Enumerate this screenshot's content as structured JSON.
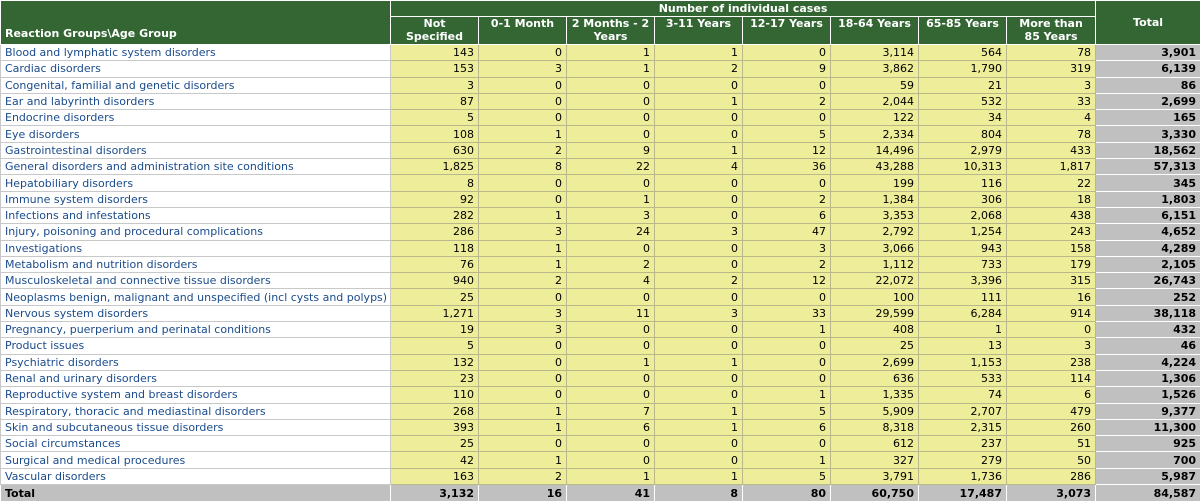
{
  "table": {
    "corner_label": "Reaction Groups\\Age Group",
    "group_label": "Number of individual cases",
    "columns": [
      "Not Specified",
      "0-1 Month",
      "2 Months - 2 Years",
      "3-11 Years",
      "12-17 Years",
      "18-64 Years",
      "65-85 Years",
      "More than 85 Years"
    ],
    "total_label": "Total",
    "rows": [
      {
        "name": "Blood and lymphatic system disorders",
        "values": [
          "143",
          "0",
          "1",
          "1",
          "0",
          "3,114",
          "564",
          "78"
        ],
        "total": "3,901"
      },
      {
        "name": "Cardiac disorders",
        "values": [
          "153",
          "3",
          "1",
          "2",
          "9",
          "3,862",
          "1,790",
          "319"
        ],
        "total": "6,139"
      },
      {
        "name": "Congenital, familial and genetic disorders",
        "values": [
          "3",
          "0",
          "0",
          "0",
          "0",
          "59",
          "21",
          "3"
        ],
        "total": "86"
      },
      {
        "name": "Ear and labyrinth disorders",
        "values": [
          "87",
          "0",
          "0",
          "1",
          "2",
          "2,044",
          "532",
          "33"
        ],
        "total": "2,699"
      },
      {
        "name": "Endocrine disorders",
        "values": [
          "5",
          "0",
          "0",
          "0",
          "0",
          "122",
          "34",
          "4"
        ],
        "total": "165"
      },
      {
        "name": "Eye disorders",
        "values": [
          "108",
          "1",
          "0",
          "0",
          "5",
          "2,334",
          "804",
          "78"
        ],
        "total": "3,330"
      },
      {
        "name": "Gastrointestinal disorders",
        "values": [
          "630",
          "2",
          "9",
          "1",
          "12",
          "14,496",
          "2,979",
          "433"
        ],
        "total": "18,562"
      },
      {
        "name": "General disorders and administration site conditions",
        "values": [
          "1,825",
          "8",
          "22",
          "4",
          "36",
          "43,288",
          "10,313",
          "1,817"
        ],
        "total": "57,313"
      },
      {
        "name": "Hepatobiliary disorders",
        "values": [
          "8",
          "0",
          "0",
          "0",
          "0",
          "199",
          "116",
          "22"
        ],
        "total": "345"
      },
      {
        "name": "Immune system disorders",
        "values": [
          "92",
          "0",
          "1",
          "0",
          "2",
          "1,384",
          "306",
          "18"
        ],
        "total": "1,803"
      },
      {
        "name": "Infections and infestations",
        "values": [
          "282",
          "1",
          "3",
          "0",
          "6",
          "3,353",
          "2,068",
          "438"
        ],
        "total": "6,151"
      },
      {
        "name": "Injury, poisoning and procedural complications",
        "values": [
          "286",
          "3",
          "24",
          "3",
          "47",
          "2,792",
          "1,254",
          "243"
        ],
        "total": "4,652"
      },
      {
        "name": "Investigations",
        "values": [
          "118",
          "1",
          "0",
          "0",
          "3",
          "3,066",
          "943",
          "158"
        ],
        "total": "4,289"
      },
      {
        "name": "Metabolism and nutrition disorders",
        "values": [
          "76",
          "1",
          "2",
          "0",
          "2",
          "1,112",
          "733",
          "179"
        ],
        "total": "2,105"
      },
      {
        "name": "Musculoskeletal and connective tissue disorders",
        "values": [
          "940",
          "2",
          "4",
          "2",
          "12",
          "22,072",
          "3,396",
          "315"
        ],
        "total": "26,743"
      },
      {
        "name": "Neoplasms benign, malignant and unspecified (incl cysts and polyps)",
        "values": [
          "25",
          "0",
          "0",
          "0",
          "0",
          "100",
          "111",
          "16"
        ],
        "total": "252"
      },
      {
        "name": "Nervous system disorders",
        "values": [
          "1,271",
          "3",
          "11",
          "3",
          "33",
          "29,599",
          "6,284",
          "914"
        ],
        "total": "38,118"
      },
      {
        "name": "Pregnancy, puerperium and perinatal conditions",
        "values": [
          "19",
          "3",
          "0",
          "0",
          "1",
          "408",
          "1",
          "0"
        ],
        "total": "432"
      },
      {
        "name": "Product issues",
        "values": [
          "5",
          "0",
          "0",
          "0",
          "0",
          "25",
          "13",
          "3"
        ],
        "total": "46"
      },
      {
        "name": "Psychiatric disorders",
        "values": [
          "132",
          "0",
          "1",
          "1",
          "0",
          "2,699",
          "1,153",
          "238"
        ],
        "total": "4,224"
      },
      {
        "name": "Renal and urinary disorders",
        "values": [
          "23",
          "0",
          "0",
          "0",
          "0",
          "636",
          "533",
          "114"
        ],
        "total": "1,306"
      },
      {
        "name": "Reproductive system and breast disorders",
        "values": [
          "110",
          "0",
          "0",
          "0",
          "1",
          "1,335",
          "74",
          "6"
        ],
        "total": "1,526"
      },
      {
        "name": "Respiratory, thoracic and mediastinal disorders",
        "values": [
          "268",
          "1",
          "7",
          "1",
          "5",
          "5,909",
          "2,707",
          "479"
        ],
        "total": "9,377"
      },
      {
        "name": "Skin and subcutaneous tissue disorders",
        "values": [
          "393",
          "1",
          "6",
          "1",
          "6",
          "8,318",
          "2,315",
          "260"
        ],
        "total": "11,300"
      },
      {
        "name": "Social circumstances",
        "values": [
          "25",
          "0",
          "0",
          "0",
          "0",
          "612",
          "237",
          "51"
        ],
        "total": "925"
      },
      {
        "name": "Surgical and medical procedures",
        "values": [
          "42",
          "1",
          "0",
          "0",
          "1",
          "327",
          "279",
          "50"
        ],
        "total": "700"
      },
      {
        "name": "Vascular disorders",
        "values": [
          "163",
          "2",
          "1",
          "1",
          "5",
          "3,791",
          "1,736",
          "286"
        ],
        "total": "5,987"
      }
    ],
    "totals_row": {
      "label": "Total",
      "values": [
        "3,132",
        "16",
        "41",
        "8",
        "80",
        "60,750",
        "17,487",
        "3,073"
      ],
      "total": "84,587"
    }
  },
  "colors": {
    "header_bg": "#336633",
    "cell_bg": "#eded9a",
    "total_bg": "#c0c0c0",
    "row_label": "#1a4b8c"
  }
}
